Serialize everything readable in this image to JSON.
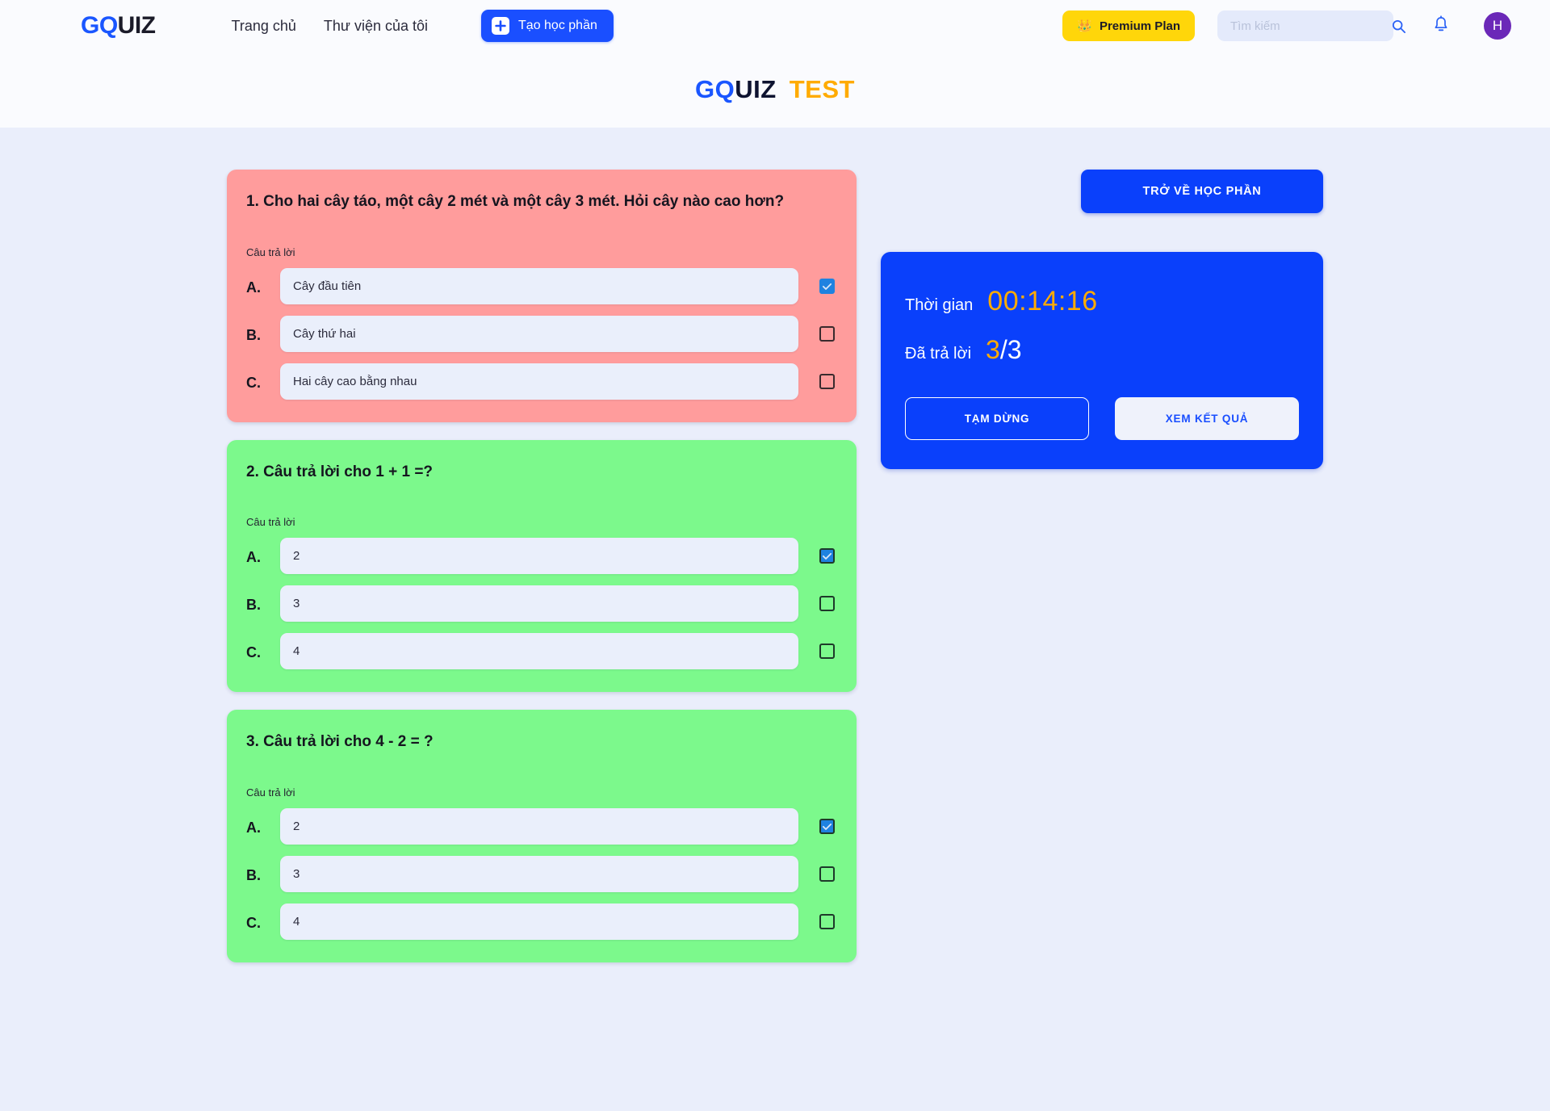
{
  "header": {
    "brand": {
      "part1": "GQ",
      "part2": "UIZ"
    },
    "nav": [
      {
        "label": "Trang chủ",
        "name": "nav-home"
      },
      {
        "label": "Thư viện của tôi",
        "name": "nav-my-library"
      }
    ],
    "create_button": "Tạo học phần",
    "premium_button": "Premium Plan",
    "premium_icon": "crown-icon",
    "premium_color": "#ffd60a",
    "search_placeholder": "Tìm kiếm",
    "search_value": "",
    "notification_icon": "bell-icon",
    "avatar_initial": "H",
    "avatar_color": "#6b28b8"
  },
  "subheader": {
    "title_g": "GQ",
    "title_uiz": "UIZ",
    "title_test": "TEST",
    "accent_blue": "#1a56ff",
    "accent_orange": "#ffab00"
  },
  "side_panel": {
    "back_button": "TRỞ VỀ HỌC PHẦN",
    "time_label": "Thời gian",
    "time_value": "00:14:16",
    "answered_label": "Đã trả lời",
    "answered_done": "3",
    "answered_sep": "/",
    "answered_total": "3",
    "pause_button": "TẠM DỪNG",
    "result_button": "XEM KẾT QUẢ",
    "panel_color": "#0a40fb"
  },
  "answers_label": "Câu trả lời",
  "questions": [
    {
      "number": "1.",
      "title": "1. Cho hai cây táo, một cây 2 mét và một cây 3 mét. Hỏi cây nào cao hơn?",
      "state": "wrong",
      "color": "#ff9c9c",
      "options": [
        {
          "letter": "A.",
          "value": "Cây đầu tiên",
          "checked": true
        },
        {
          "letter": "B.",
          "value": "Cây thứ hai",
          "checked": false
        },
        {
          "letter": "C.",
          "value": "Hai cây cao bằng nhau",
          "checked": false
        }
      ]
    },
    {
      "number": "2.",
      "title": "2. Câu trả lời cho 1 + 1 =?",
      "state": "correct",
      "color": "#7cf98c",
      "options": [
        {
          "letter": "A.",
          "value": "2",
          "checked": true
        },
        {
          "letter": "B.",
          "value": "3",
          "checked": false
        },
        {
          "letter": "C.",
          "value": "4",
          "checked": false
        }
      ]
    },
    {
      "number": "3.",
      "title": "3. Câu trả lời cho 4 - 2 = ?",
      "state": "correct",
      "color": "#7cf98c",
      "options": [
        {
          "letter": "A.",
          "value": "2",
          "checked": true
        },
        {
          "letter": "B.",
          "value": "3",
          "checked": false
        },
        {
          "letter": "C.",
          "value": "4",
          "checked": false
        }
      ]
    }
  ]
}
